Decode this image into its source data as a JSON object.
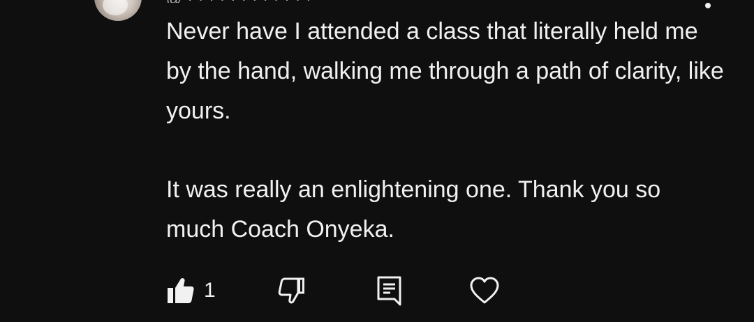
{
  "comment": {
    "author_partial": "@ · · · · · · · · · · · ·",
    "paragraphs": [
      "Never have I attended a class that literally held me by the hand, walking me through a path of clarity, like yours.",
      "It was really an enlightening one. Thank you so much Coach Onyeka."
    ],
    "like_count": "1"
  },
  "icons": {
    "like": "thumbs-up-icon",
    "dislike": "thumbs-down-icon",
    "reply": "reply-comment-icon",
    "heart": "heart-icon",
    "more": "more-vertical-icon"
  },
  "colors": {
    "background": "#0f0f0f",
    "text": "#f1f1f1",
    "secondary_text": "#aaaaaa"
  }
}
